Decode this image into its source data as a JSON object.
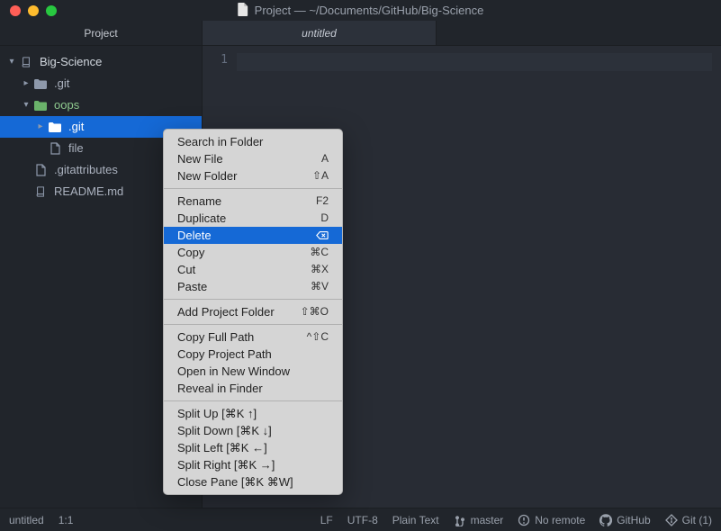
{
  "window": {
    "title": "Project — ~/Documents/GitHub/Big-Science"
  },
  "sidebar": {
    "tab_label": "Project",
    "tree": {
      "root": {
        "label": "Big-Science"
      },
      "items": [
        {
          "label": ".git",
          "icon": "folder",
          "indent": 1,
          "expand": "collapsed"
        },
        {
          "label": "oops",
          "icon": "folder",
          "indent": 1,
          "expand": "open",
          "open_color": "#6ab26a"
        },
        {
          "label": ".git",
          "icon": "folder",
          "indent": 2,
          "expand": "collapsed",
          "selected": true
        },
        {
          "label": "file",
          "icon": "file",
          "indent": 2,
          "expand": "none"
        },
        {
          "label": ".gitattributes",
          "icon": "file",
          "indent": 1,
          "expand": "none"
        },
        {
          "label": "README.md",
          "icon": "book",
          "indent": 1,
          "expand": "none"
        }
      ]
    }
  },
  "editor": {
    "tab_label": "untitled",
    "line_number": "1"
  },
  "context_menu": {
    "groups": [
      [
        {
          "label": "Search in Folder",
          "shortcut": ""
        },
        {
          "label": "New File",
          "shortcut": "A"
        },
        {
          "label": "New Folder",
          "shortcut": "⇧A"
        }
      ],
      [
        {
          "label": "Rename",
          "shortcut": "F2"
        },
        {
          "label": "Duplicate",
          "shortcut": "D"
        },
        {
          "label": "Delete",
          "shortcut": "⌫",
          "selected": true,
          "shortcut_icon": "backspace"
        },
        {
          "label": "Copy",
          "shortcut": "⌘C"
        },
        {
          "label": "Cut",
          "shortcut": "⌘X"
        },
        {
          "label": "Paste",
          "shortcut": "⌘V"
        }
      ],
      [
        {
          "label": "Add Project Folder",
          "shortcut": "⇧⌘O"
        }
      ],
      [
        {
          "label": "Copy Full Path",
          "shortcut": "^⇧C"
        },
        {
          "label": "Copy Project Path",
          "shortcut": ""
        },
        {
          "label": "Open in New Window",
          "shortcut": ""
        },
        {
          "label": "Reveal in Finder",
          "shortcut": ""
        }
      ],
      [
        {
          "label": "Split Up [⌘K ↑]",
          "shortcut": ""
        },
        {
          "label": "Split Down [⌘K ↓]",
          "shortcut": ""
        },
        {
          "label": "Split Left [⌘K ←]",
          "shortcut": ""
        },
        {
          "label": "Split Right [⌘K →]",
          "shortcut": ""
        },
        {
          "label": "Close Pane [⌘K ⌘W]",
          "shortcut": ""
        }
      ]
    ]
  },
  "status": {
    "file": "untitled",
    "cursor": "1:1",
    "eol": "LF",
    "encoding": "UTF-8",
    "lang": "Plain Text",
    "branch": "master",
    "remote": "No remote",
    "github": "GitHub",
    "git": "Git (1)"
  }
}
